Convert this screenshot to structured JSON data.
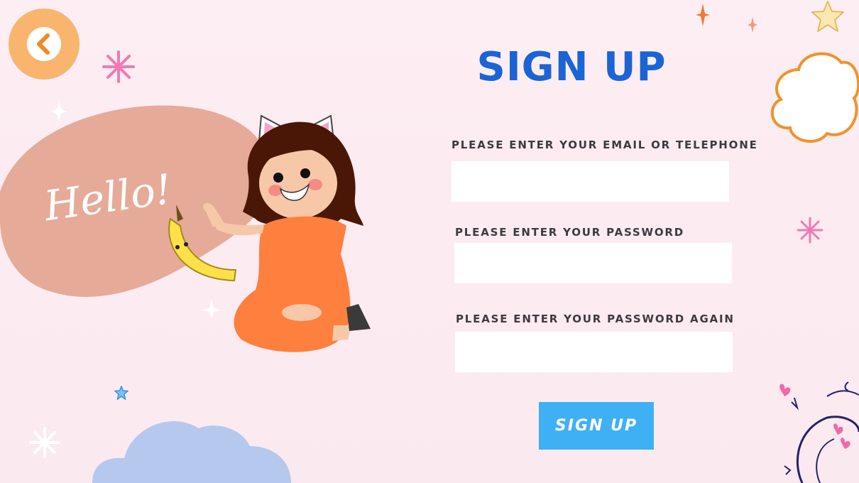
{
  "header": {
    "title": "SIGN UP"
  },
  "hero": {
    "greeting": "Hello!"
  },
  "form": {
    "email_label": "PLEASE ENTER YOUR EMAIL OR TELEPHONE",
    "email_value": "",
    "password_label": "PLEASE ENTER YOUR PASSWORD",
    "password_value": "",
    "confirm_label": "PLEASE ENTER YOUR PASSWORD AGAIN",
    "confirm_value": "",
    "submit_label": "SIGN UP"
  },
  "icons": {
    "back": "chevron-left-icon"
  },
  "colors": {
    "background": "#fdeef3",
    "title": "#1a64d6",
    "back_button": "#f9b56e",
    "submit_button": "#3fb0f3",
    "blob": "#e6aa99",
    "cloud_blue": "#b6c8ee",
    "cloud_orange_outline": "#f1922a"
  }
}
